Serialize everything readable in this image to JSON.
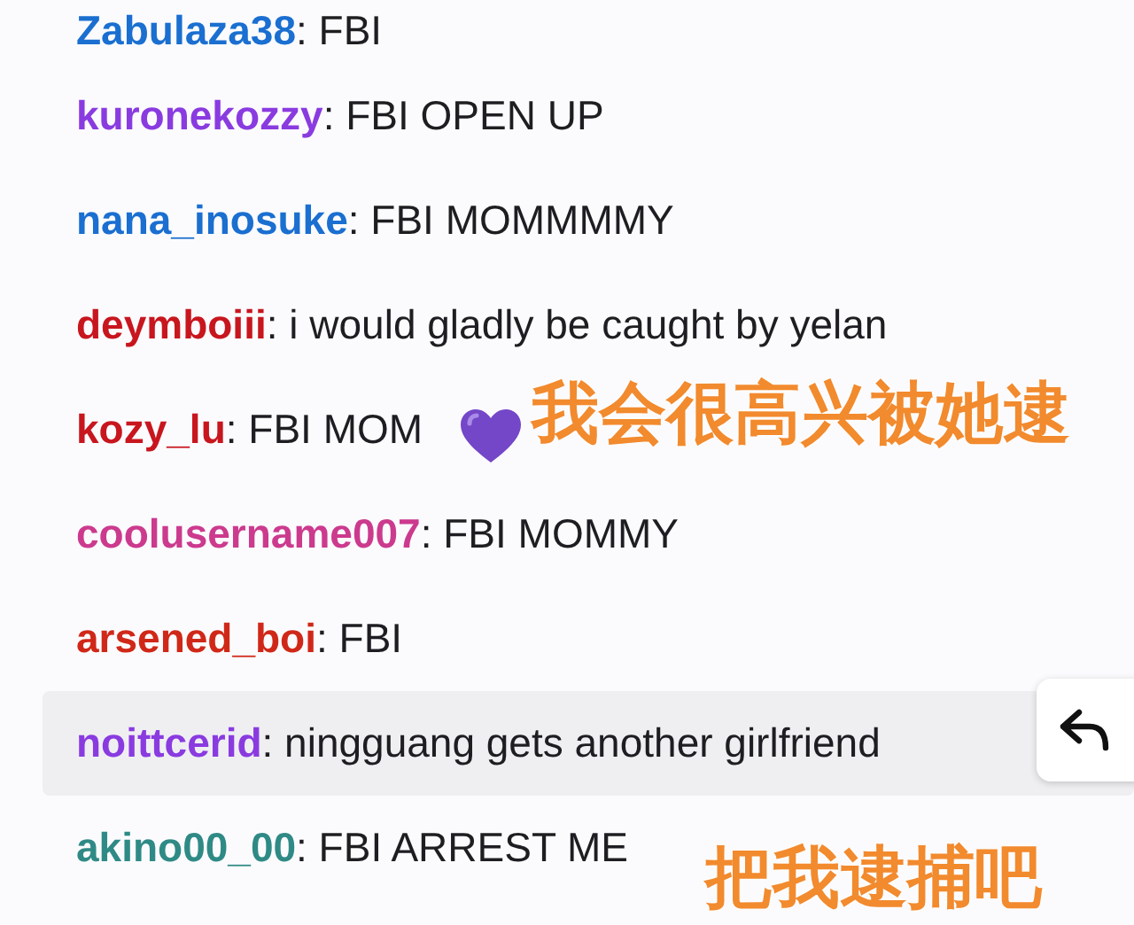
{
  "messages": [
    {
      "kind": "plain",
      "user": "Zabulaza38",
      "color": "#1a6fd0",
      "text": ": FBI",
      "highlighted": false
    },
    {
      "kind": "plain",
      "user": "kuronekozzy",
      "color": "#8a3be0",
      "text": ": FBI OPEN UP",
      "highlighted": false
    },
    {
      "kind": "plain",
      "user": "nana_inosuke",
      "color": "#1a6fd0",
      "text": ": FBI MOMMMMY",
      "highlighted": false
    },
    {
      "kind": "plain",
      "user": "deymboiii",
      "color": "#c8161e",
      "text": ": i would gladly be caught by yelan",
      "highlighted": false
    },
    {
      "kind": "heart",
      "user": "kozy_lu",
      "color": "#c8161e",
      "text": ": FBI MOM",
      "highlighted": false
    },
    {
      "kind": "plain",
      "user": "coolusername007",
      "color": "#cc3a8e",
      "text": ": FBI MOMMY",
      "highlighted": false
    },
    {
      "kind": "plain",
      "user": "arsened_boi",
      "color": "#d02818",
      "text": ": FBI",
      "highlighted": false
    },
    {
      "kind": "plain",
      "user": "noittcerid",
      "color": "#8a3be0",
      "text": ": ningguang gets another girlfriend",
      "highlighted": true
    },
    {
      "kind": "plain",
      "user": "akino00_00",
      "color": "#2f8a86",
      "text": ": FBI ARREST ME",
      "highlighted": false
    }
  ],
  "annotations": [
    "我会很高兴被她逮",
    "把我逮捕吧"
  ]
}
